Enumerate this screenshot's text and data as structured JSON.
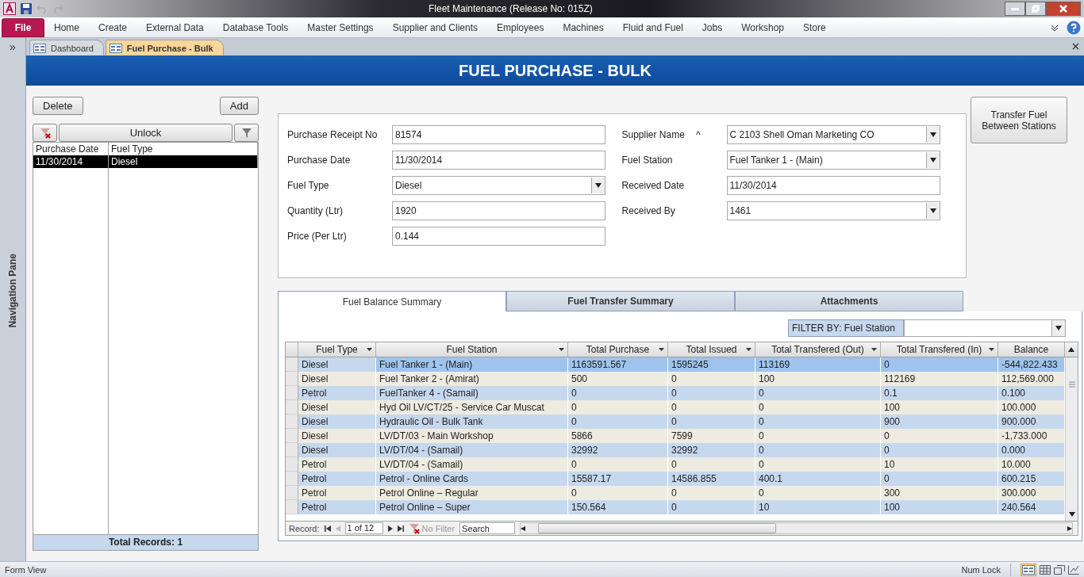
{
  "window": {
    "title": "Fleet Maintenance (Release No: 015Z)"
  },
  "ribbon": {
    "tabs": [
      {
        "label": "File",
        "kind": "file",
        "selected": false
      },
      {
        "label": "Home",
        "kind": "tab",
        "selected": false
      },
      {
        "label": "Create",
        "kind": "tab",
        "selected": false
      },
      {
        "label": "External Data",
        "kind": "tab",
        "selected": false
      },
      {
        "label": "Database Tools",
        "kind": "tab",
        "selected": false
      },
      {
        "label": "Master Settings",
        "kind": "tab",
        "selected": false
      },
      {
        "label": "Supplier and Clients",
        "kind": "tab",
        "selected": false
      },
      {
        "label": "Employees",
        "kind": "tab",
        "selected": false
      },
      {
        "label": "Machines",
        "kind": "tab",
        "selected": false
      },
      {
        "label": "Fluid and Fuel",
        "kind": "tab",
        "selected": false
      },
      {
        "label": "Jobs",
        "kind": "tab",
        "selected": false
      },
      {
        "label": "Workshop",
        "kind": "tab",
        "selected": false
      },
      {
        "label": "Store",
        "kind": "tab",
        "selected": false
      }
    ]
  },
  "navigation_pane": {
    "toggle": "»",
    "label": "Navigation Pane"
  },
  "document_tabs": [
    {
      "label": "Dashboard",
      "selected": false
    },
    {
      "label": "Fuel Purchase - Bulk",
      "selected": true
    }
  ],
  "form": {
    "title": "FUEL PURCHASE - BULK",
    "list_panel": {
      "buttons": [
        "Delete",
        "Add"
      ],
      "unlock": "Unlock",
      "columns": [
        "Purchase Date",
        "Fuel Type"
      ],
      "rows": [
        {
          "cells": [
            "11/30/2014",
            "Diesel"
          ],
          "selected": true
        }
      ],
      "footer": "Total Records: 1"
    },
    "fields_left": [
      {
        "label": "Purchase Receipt No",
        "value": "81574",
        "kind": "text"
      },
      {
        "label": "Purchase Date",
        "value": "11/30/2014",
        "kind": "text"
      },
      {
        "label": "Fuel Type",
        "value": "Diesel",
        "kind": "dropdown"
      },
      {
        "label": "Quantity (Ltr)",
        "value": "1920",
        "kind": "text"
      },
      {
        "label": "Price (Per Ltr)",
        "value": "0.144",
        "kind": "text"
      }
    ],
    "fields_right": [
      {
        "label": "Supplier Name",
        "marker": "^",
        "value": "C 2103 Shell Oman Marketing CO",
        "kind": "dropdown"
      },
      {
        "label": "Fuel Station",
        "value": "Fuel Tanker 1 - (Main)",
        "kind": "dropdown"
      },
      {
        "label": "Received Date",
        "value": "11/30/2014",
        "kind": "text"
      },
      {
        "label": "Received By",
        "value": "1461",
        "kind": "dropdown"
      }
    ],
    "transfer_button": "Transfer Fuel Between Stations",
    "subform": {
      "tabs": [
        {
          "label": "Fuel Balance Summary",
          "selected": true
        },
        {
          "label": "Fuel Transfer Summary",
          "selected": false
        },
        {
          "label": "Attachments",
          "selected": false
        }
      ],
      "filter": {
        "label": "FILTER BY: Fuel Station"
      },
      "columns": [
        "Fuel Type",
        "Fuel Station",
        "Total Purchase",
        "Total Issued",
        "Total Transfered (Out)",
        "Total Transfered (In)",
        "Balance"
      ],
      "rows": [
        {
          "cells": [
            "Diesel",
            "Fuel Tanker 1 - (Main)",
            "1163591.567",
            "1595245",
            "113169",
            "0",
            "-544,822.433"
          ],
          "selected": true
        },
        {
          "cells": [
            "Diesel",
            "Fuel Tanker 2 - (Amirat)",
            "500",
            "0",
            "100",
            "112169",
            "112,569.000"
          ],
          "selected": false
        },
        {
          "cells": [
            "Petrol",
            "FuelTanker 4 - (Samail)",
            "0",
            "0",
            "0",
            "0.1",
            "0.100"
          ],
          "selected": false
        },
        {
          "cells": [
            "Diesel",
            "Hyd Oil LV/CT/25 - Service Car Muscat",
            "0",
            "0",
            "0",
            "100",
            "100.000"
          ],
          "selected": false
        },
        {
          "cells": [
            "Diesel",
            "Hydraulic Oil - Bulk Tank",
            "0",
            "0",
            "0",
            "900",
            "900.000"
          ],
          "selected": false
        },
        {
          "cells": [
            "Diesel",
            "LV/DT/03 - Main Workshop",
            "5866",
            "7599",
            "0",
            "0",
            "-1,733.000"
          ],
          "selected": false
        },
        {
          "cells": [
            "Diesel",
            "LV/DT/04 - (Samail)",
            "32992",
            "32992",
            "0",
            "0",
            "0.000"
          ],
          "selected": false
        },
        {
          "cells": [
            "Petrol",
            "LV/DT/04 - (Samail)",
            "0",
            "0",
            "0",
            "10",
            "10.000"
          ],
          "selected": false
        },
        {
          "cells": [
            "Petrol",
            "Petrol - Online Cards",
            "15587.17",
            "14586.855",
            "400.1",
            "0",
            "600.215"
          ],
          "selected": false
        },
        {
          "cells": [
            "Petrol",
            "Petrol Online – Regular",
            "0",
            "0",
            "0",
            "300",
            "300.000"
          ],
          "selected": false
        },
        {
          "cells": [
            "Petrol",
            "Petrol Online – Super",
            "150.564",
            "0",
            "10",
            "100",
            "240.564"
          ],
          "selected": false
        }
      ],
      "record_nav": {
        "label": "Record:",
        "position": "1 of 12",
        "filter": "No Filter",
        "search_placeholder": "Search"
      }
    }
  },
  "status_bar": {
    "left": "Form View",
    "right": "Num Lock"
  }
}
